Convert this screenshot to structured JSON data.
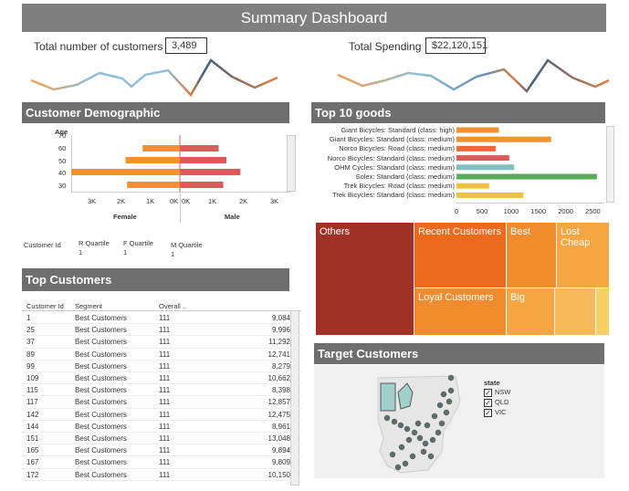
{
  "title": "Summary Dashboard",
  "kpis": {
    "customers_label": "Total number of customers",
    "customers_value": "3,489",
    "spending_label": "Total Spending",
    "spending_value": "$22,120,151"
  },
  "sections": {
    "demographic": "Customer Demographic",
    "goods": "Top 10 goods",
    "top_customers": "Top Customers",
    "target": "Target Customers"
  },
  "demographic": {
    "age_label": "Age",
    "ages": [
      "70",
      "60",
      "50",
      "40",
      "30"
    ],
    "female_ticks": [
      "3K",
      "2K",
      "1K",
      "0K"
    ],
    "male_ticks": [
      "0K",
      "1K",
      "2K",
      "3K"
    ],
    "female_label": "Female",
    "male_label": "Male",
    "female_values": [
      0,
      1200,
      1750,
      3500,
      1700
    ],
    "male_values": [
      0,
      1250,
      1500,
      1950,
      1400
    ],
    "female_color": "#f0922f",
    "male_color": "#de5a5a"
  },
  "quartiles": {
    "customer_id_label": "Customer Id",
    "r_label": "R Quartile",
    "r_value": "1",
    "f_label": "F Quartile",
    "f_value": "1",
    "m_label": "M Quartile",
    "m_value": "1"
  },
  "chart_data": {
    "type": "bar",
    "categories": [
      "Giant Bicycles: Standard (class: high)",
      "Giant Bicycles: Standard (class: medium)",
      "Norco Bicycles: Road (class: medium)",
      "Norco Bicycles: Standard (class: medium)",
      "OHM Cycles: Standard (class: medium)",
      "Solex: Standard (class: medium)",
      "Trek Bicycles: Road (class: medium)",
      "Trek Bicycles: Standard (class: medium)"
    ],
    "values": [
      780,
      1740,
      720,
      970,
      1060,
      2580,
      600,
      1230
    ],
    "colors": [
      "#f0922f",
      "#f0922f",
      "#ec6a3a",
      "#de5a5a",
      "#7fbfbf",
      "#5aaa5a",
      "#f0c040",
      "#f0c040"
    ],
    "xticks": [
      "0",
      "500",
      "1000",
      "1500",
      "2000",
      "2500"
    ],
    "xlim": [
      0,
      2650
    ]
  },
  "treemap": {
    "others": "Others",
    "recent": "Recent Customers",
    "best": "Best",
    "lost_cheap": "Lost Cheap",
    "loyal": "Loyal Customers",
    "big": "Big"
  },
  "top_customers": {
    "headers": [
      "Customer Id",
      "Segment",
      "Overall .."
    ],
    "rows": [
      [
        "1",
        "Best Customers",
        "111",
        "9,084"
      ],
      [
        "25",
        "Best Customers",
        "111",
        "9,996"
      ],
      [
        "37",
        "Best Customers",
        "111",
        "11,292"
      ],
      [
        "89",
        "Best Customers",
        "111",
        "12,741"
      ],
      [
        "99",
        "Best Customers",
        "111",
        "8,279"
      ],
      [
        "109",
        "Best Customers",
        "111",
        "10,662"
      ],
      [
        "115",
        "Best Customers",
        "111",
        "8,398"
      ],
      [
        "117",
        "Best Customers",
        "111",
        "12,857"
      ],
      [
        "142",
        "Best Customers",
        "111",
        "12,475"
      ],
      [
        "144",
        "Best Customers",
        "111",
        "8,961"
      ],
      [
        "151",
        "Best Customers",
        "111",
        "13,048"
      ],
      [
        "165",
        "Best Customers",
        "111",
        "9,894"
      ],
      [
        "167",
        "Best Customers",
        "111",
        "9,809"
      ],
      [
        "172",
        "Best Customers",
        "111",
        "10,150"
      ]
    ]
  },
  "map_legend": {
    "title": "state",
    "items": [
      "NSW",
      "QLD",
      "VIC"
    ]
  }
}
